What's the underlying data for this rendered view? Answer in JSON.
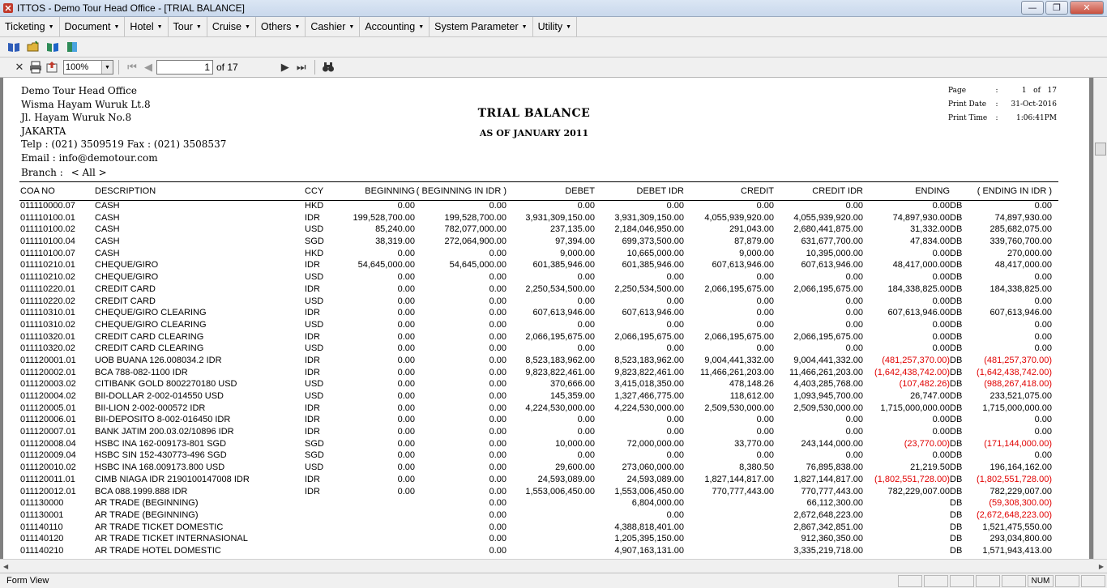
{
  "window": {
    "title": "ITTOS - Demo Tour Head Office - [TRIAL BALANCE]",
    "btn_min": "—",
    "btn_max": "❐",
    "btn_close": "✕"
  },
  "menu": [
    "Ticketing",
    "Document",
    "Hotel",
    "Tour",
    "Cruise",
    "Others",
    "Cashier",
    "Accounting",
    "System Parameter",
    "Utility"
  ],
  "report_toolbar": {
    "zoom": "100%",
    "page_value": "1",
    "page_of": "of 17"
  },
  "report": {
    "company_lines": [
      "Demo Tour Head Office",
      "Wisma Hayam Wuruk Lt.8",
      "Jl. Hayam Wuruk No.8",
      "JAKARTA",
      "Telp : (021) 3509519 Fax : (021) 3508537",
      "Email : info@demotour.com"
    ],
    "branch_label": "Branch  :",
    "branch_value": "< All >",
    "title": "TRIAL BALANCE",
    "subtitle": "AS OF JANUARY 2011",
    "meta": {
      "page_label": "Page",
      "page_no": "1",
      "page_of": "of",
      "page_total": "17",
      "print_date_label": "Print Date",
      "print_date": "31-Oct-2016",
      "print_time_label": "Print Time",
      "print_time": "1:06:41PM",
      "sep": ":"
    },
    "columns": {
      "coa": "COA NO",
      "desc": "DESCRIPTION",
      "ccy": "CCY",
      "beg": "BEGINNING",
      "begidr": "( BEGINNING IN IDR )",
      "deb": "DEBET",
      "debidr": "DEBET IDR",
      "cre": "CREDIT",
      "creidr": "CREDIT IDR",
      "end": "ENDING",
      "endidr": "( ENDING IN IDR )"
    },
    "rows": [
      {
        "coa": "011110000.07",
        "desc": "CASH",
        "ccy": "HKD",
        "beg": "0.00",
        "begidr": "0.00",
        "deb": "0.00",
        "debidr": "0.00",
        "cre": "0.00",
        "creidr": "0.00",
        "end": "0.00",
        "db": "DB",
        "endidr": "0.00"
      },
      {
        "coa": "011110100.01",
        "desc": "CASH",
        "ccy": "IDR",
        "beg": "199,528,700.00",
        "begidr": "199,528,700.00",
        "deb": "3,931,309,150.00",
        "debidr": "3,931,309,150.00",
        "cre": "4,055,939,920.00",
        "creidr": "4,055,939,920.00",
        "end": "74,897,930.00",
        "db": "DB",
        "endidr": "74,897,930.00"
      },
      {
        "coa": "011110100.02",
        "desc": "CASH",
        "ccy": "USD",
        "beg": "85,240.00",
        "begidr": "782,077,000.00",
        "deb": "237,135.00",
        "debidr": "2,184,046,950.00",
        "cre": "291,043.00",
        "creidr": "2,680,441,875.00",
        "end": "31,332.00",
        "db": "DB",
        "endidr": "285,682,075.00"
      },
      {
        "coa": "011110100.04",
        "desc": "CASH",
        "ccy": "SGD",
        "beg": "38,319.00",
        "begidr": "272,064,900.00",
        "deb": "97,394.00",
        "debidr": "699,373,500.00",
        "cre": "87,879.00",
        "creidr": "631,677,700.00",
        "end": "47,834.00",
        "db": "DB",
        "endidr": "339,760,700.00"
      },
      {
        "coa": "011110100.07",
        "desc": "CASH",
        "ccy": "HKD",
        "beg": "0.00",
        "begidr": "0.00",
        "deb": "9,000.00",
        "debidr": "10,665,000.00",
        "cre": "9,000.00",
        "creidr": "10,395,000.00",
        "end": "0.00",
        "db": "DB",
        "endidr": "270,000.00"
      },
      {
        "coa": "011110210.01",
        "desc": "CHEQUE/GIRO",
        "ccy": "IDR",
        "beg": "54,645,000.00",
        "begidr": "54,645,000.00",
        "deb": "601,385,946.00",
        "debidr": "601,385,946.00",
        "cre": "607,613,946.00",
        "creidr": "607,613,946.00",
        "end": "48,417,000.00",
        "db": "DB",
        "endidr": "48,417,000.00"
      },
      {
        "coa": "011110210.02",
        "desc": "CHEQUE/GIRO",
        "ccy": "USD",
        "beg": "0.00",
        "begidr": "0.00",
        "deb": "0.00",
        "debidr": "0.00",
        "cre": "0.00",
        "creidr": "0.00",
        "end": "0.00",
        "db": "DB",
        "endidr": "0.00"
      },
      {
        "coa": "011110220.01",
        "desc": "CREDIT CARD",
        "ccy": "IDR",
        "beg": "0.00",
        "begidr": "0.00",
        "deb": "2,250,534,500.00",
        "debidr": "2,250,534,500.00",
        "cre": "2,066,195,675.00",
        "creidr": "2,066,195,675.00",
        "end": "184,338,825.00",
        "db": "DB",
        "endidr": "184,338,825.00"
      },
      {
        "coa": "011110220.02",
        "desc": "CREDIT CARD",
        "ccy": "USD",
        "beg": "0.00",
        "begidr": "0.00",
        "deb": "0.00",
        "debidr": "0.00",
        "cre": "0.00",
        "creidr": "0.00",
        "end": "0.00",
        "db": "DB",
        "endidr": "0.00"
      },
      {
        "coa": "011110310.01",
        "desc": "CHEQUE/GIRO CLEARING",
        "ccy": "IDR",
        "beg": "0.00",
        "begidr": "0.00",
        "deb": "607,613,946.00",
        "debidr": "607,613,946.00",
        "cre": "0.00",
        "creidr": "0.00",
        "end": "607,613,946.00",
        "db": "DB",
        "endidr": "607,613,946.00"
      },
      {
        "coa": "011110310.02",
        "desc": "CHEQUE/GIRO CLEARING",
        "ccy": "USD",
        "beg": "0.00",
        "begidr": "0.00",
        "deb": "0.00",
        "debidr": "0.00",
        "cre": "0.00",
        "creidr": "0.00",
        "end": "0.00",
        "db": "DB",
        "endidr": "0.00"
      },
      {
        "coa": "011110320.01",
        "desc": "CREDIT CARD CLEARING",
        "ccy": "IDR",
        "beg": "0.00",
        "begidr": "0.00",
        "deb": "2,066,195,675.00",
        "debidr": "2,066,195,675.00",
        "cre": "2,066,195,675.00",
        "creidr": "2,066,195,675.00",
        "end": "0.00",
        "db": "DB",
        "endidr": "0.00"
      },
      {
        "coa": "011110320.02",
        "desc": "CREDIT CARD CLEARING",
        "ccy": "USD",
        "beg": "0.00",
        "begidr": "0.00",
        "deb": "0.00",
        "debidr": "0.00",
        "cre": "0.00",
        "creidr": "0.00",
        "end": "0.00",
        "db": "DB",
        "endidr": "0.00"
      },
      {
        "coa": "011120001.01",
        "desc": "UOB BUANA 126.008034.2 IDR",
        "ccy": "IDR",
        "beg": "0.00",
        "begidr": "0.00",
        "deb": "8,523,183,962.00",
        "debidr": "8,523,183,962.00",
        "cre": "9,004,441,332.00",
        "creidr": "9,004,441,332.00",
        "end": "(481,257,370.00)",
        "db": "DB",
        "endidr": "(481,257,370.00)"
      },
      {
        "coa": "011120002.01",
        "desc": "BCA 788-082-1100 IDR",
        "ccy": "IDR",
        "beg": "0.00",
        "begidr": "0.00",
        "deb": "9,823,822,461.00",
        "debidr": "9,823,822,461.00",
        "cre": "11,466,261,203.00",
        "creidr": "11,466,261,203.00",
        "end": "(1,642,438,742.00)",
        "db": "DB",
        "endidr": "(1,642,438,742.00)"
      },
      {
        "coa": "011120003.02",
        "desc": "CITIBANK GOLD 8002270180 USD",
        "ccy": "USD",
        "beg": "0.00",
        "begidr": "0.00",
        "deb": "370,666.00",
        "debidr": "3,415,018,350.00",
        "cre": "478,148.26",
        "creidr": "4,403,285,768.00",
        "end": "(107,482.26)",
        "db": "DB",
        "endidr": "(988,267,418.00)"
      },
      {
        "coa": "011120004.02",
        "desc": "BII-DOLLAR 2-002-014550 USD",
        "ccy": "USD",
        "beg": "0.00",
        "begidr": "0.00",
        "deb": "145,359.00",
        "debidr": "1,327,466,775.00",
        "cre": "118,612.00",
        "creidr": "1,093,945,700.00",
        "end": "26,747.00",
        "db": "DB",
        "endidr": "233,521,075.00"
      },
      {
        "coa": "011120005.01",
        "desc": "BII-LION 2-002-000572 IDR",
        "ccy": "IDR",
        "beg": "0.00",
        "begidr": "0.00",
        "deb": "4,224,530,000.00",
        "debidr": "4,224,530,000.00",
        "cre": "2,509,530,000.00",
        "creidr": "2,509,530,000.00",
        "end": "1,715,000,000.00",
        "db": "DB",
        "endidr": "1,715,000,000.00"
      },
      {
        "coa": "011120006.01",
        "desc": "BII-DEPOSITO 8-002-016450 IDR",
        "ccy": "IDR",
        "beg": "0.00",
        "begidr": "0.00",
        "deb": "0.00",
        "debidr": "0.00",
        "cre": "0.00",
        "creidr": "0.00",
        "end": "0.00",
        "db": "DB",
        "endidr": "0.00"
      },
      {
        "coa": "011120007.01",
        "desc": "BANK JATIM 200.03.02/10896 IDR",
        "ccy": "IDR",
        "beg": "0.00",
        "begidr": "0.00",
        "deb": "0.00",
        "debidr": "0.00",
        "cre": "0.00",
        "creidr": "0.00",
        "end": "0.00",
        "db": "DB",
        "endidr": "0.00"
      },
      {
        "coa": "011120008.04",
        "desc": "HSBC INA 162-009173-801 SGD",
        "ccy": "SGD",
        "beg": "0.00",
        "begidr": "0.00",
        "deb": "10,000.00",
        "debidr": "72,000,000.00",
        "cre": "33,770.00",
        "creidr": "243,144,000.00",
        "end": "(23,770.00)",
        "db": "DB",
        "endidr": "(171,144,000.00)"
      },
      {
        "coa": "011120009.04",
        "desc": "HSBC SIN 152-430773-496 SGD",
        "ccy": "SGD",
        "beg": "0.00",
        "begidr": "0.00",
        "deb": "0.00",
        "debidr": "0.00",
        "cre": "0.00",
        "creidr": "0.00",
        "end": "0.00",
        "db": "DB",
        "endidr": "0.00"
      },
      {
        "coa": "011120010.02",
        "desc": "HSBC INA 168.009173.800 USD",
        "ccy": "USD",
        "beg": "0.00",
        "begidr": "0.00",
        "deb": "29,600.00",
        "debidr": "273,060,000.00",
        "cre": "8,380.50",
        "creidr": "76,895,838.00",
        "end": "21,219.50",
        "db": "DB",
        "endidr": "196,164,162.00"
      },
      {
        "coa": "011120011.01",
        "desc": "CIMB NIAGA IDR 2190100147008 IDR",
        "ccy": "IDR",
        "beg": "0.00",
        "begidr": "0.00",
        "deb": "24,593,089.00",
        "debidr": "24,593,089.00",
        "cre": "1,827,144,817.00",
        "creidr": "1,827,144,817.00",
        "end": "(1,802,551,728.00)",
        "db": "DB",
        "endidr": "(1,802,551,728.00)"
      },
      {
        "coa": "011120012.01",
        "desc": "BCA 088.1999.888 IDR",
        "ccy": "IDR",
        "beg": "0.00",
        "begidr": "0.00",
        "deb": "1,553,006,450.00",
        "debidr": "1,553,006,450.00",
        "cre": "770,777,443.00",
        "creidr": "770,777,443.00",
        "end": "782,229,007.00",
        "db": "DB",
        "endidr": "782,229,007.00"
      },
      {
        "coa": "011130000",
        "desc": "AR TRADE (BEGINNING)",
        "ccy": "",
        "beg": "",
        "begidr": "0.00",
        "deb": "",
        "debidr": "6,804,000.00",
        "cre": "",
        "creidr": "66,112,300.00",
        "end": "",
        "db": "DB",
        "endidr": "(59,308,300.00)"
      },
      {
        "coa": "011130001",
        "desc": "AR TRADE (BEGINNING)",
        "ccy": "",
        "beg": "",
        "begidr": "0.00",
        "deb": "",
        "debidr": "0.00",
        "cre": "",
        "creidr": "2,672,648,223.00",
        "end": "",
        "db": "DB",
        "endidr": "(2,672,648,223.00)"
      },
      {
        "coa": "011140110",
        "desc": "AR TRADE TICKET DOMESTIC",
        "ccy": "",
        "beg": "",
        "begidr": "0.00",
        "deb": "",
        "debidr": "4,388,818,401.00",
        "cre": "",
        "creidr": "2,867,342,851.00",
        "end": "",
        "db": "DB",
        "endidr": "1,521,475,550.00"
      },
      {
        "coa": "011140120",
        "desc": "AR TRADE TICKET INTERNASIONAL",
        "ccy": "",
        "beg": "",
        "begidr": "0.00",
        "deb": "",
        "debidr": "1,205,395,150.00",
        "cre": "",
        "creidr": "912,360,350.00",
        "end": "",
        "db": "DB",
        "endidr": "293,034,800.00"
      },
      {
        "coa": "011140210",
        "desc": "AR TRADE HOTEL DOMESTIC",
        "ccy": "",
        "beg": "",
        "begidr": "0.00",
        "deb": "",
        "debidr": "4,907,163,131.00",
        "cre": "",
        "creidr": "3,335,219,718.00",
        "end": "",
        "db": "DB",
        "endidr": "1,571,943,413.00"
      }
    ]
  },
  "status": {
    "text": "Form View",
    "num": "NUM"
  },
  "colors": {
    "negative": "#e00000"
  }
}
